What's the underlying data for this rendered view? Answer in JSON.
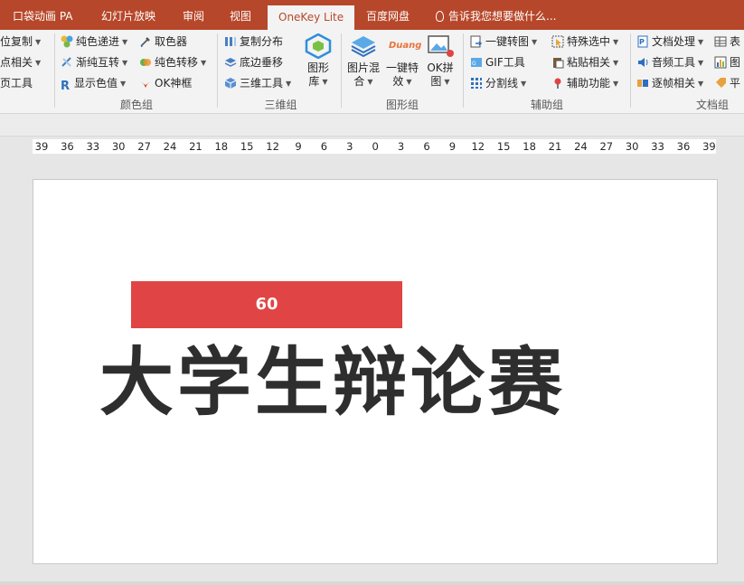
{
  "tabs": [
    {
      "label": "口袋动画 PA"
    },
    {
      "label": "幻灯片放映"
    },
    {
      "label": "审阅"
    },
    {
      "label": "视图"
    },
    {
      "label": "OneKey Lite"
    },
    {
      "label": "百度网盘"
    },
    {
      "label": "告诉我您想要做什么..."
    }
  ],
  "ribbon": {
    "col0": [
      "位复制",
      "点相关",
      "页工具"
    ],
    "color_group": {
      "items": [
        "纯色递进",
        "渐纯互转",
        "显示色值",
        "取色器",
        "纯色转移",
        "OK神框"
      ],
      "label": "颜色组"
    },
    "three_d_group": {
      "items": [
        "复制分布",
        "底边垂移",
        "三维工具"
      ],
      "big": [
        "图形",
        "库"
      ],
      "label": "三维组"
    },
    "shape_group": {
      "big1": [
        "图片混",
        "合"
      ],
      "big2": [
        "一键特",
        "效"
      ],
      "big3": [
        "OK拼",
        "图"
      ],
      "duang": "Duang",
      "label": "图形组"
    },
    "aux_group": {
      "items": [
        "一键转图",
        "GIF工具",
        "分割线",
        "特殊选中",
        "粘贴相关",
        "辅助功能"
      ],
      "label": "辅助组"
    },
    "doc_group": {
      "items": [
        "文档处理",
        "音频工具",
        "逐帧相关",
        "表",
        "图",
        "平"
      ],
      "label": "文档组"
    }
  },
  "ruler": [
    "39",
    "36",
    "33",
    "30",
    "27",
    "24",
    "21",
    "18",
    "15",
    "12",
    "9",
    "6",
    "3",
    "0",
    "3",
    "6",
    "9",
    "12",
    "15",
    "18",
    "21",
    "24",
    "27",
    "30",
    "33",
    "36",
    "39"
  ],
  "slide": {
    "bar_text": "60",
    "title": "大学生辩论赛"
  },
  "colors": {
    "tab_bar": "#b7472a",
    "bar": "#e04444",
    "title": "#2e2e2e"
  }
}
